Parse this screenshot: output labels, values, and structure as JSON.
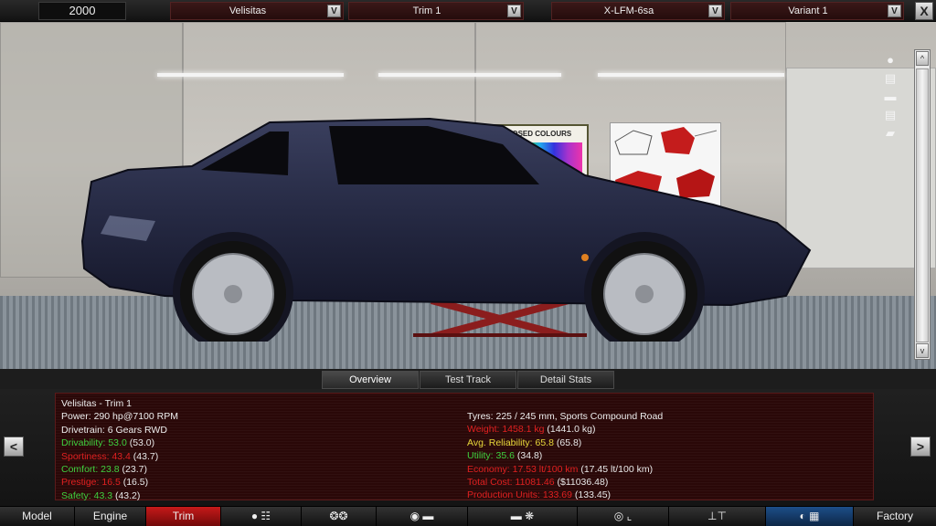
{
  "topbar": {
    "year": "2000",
    "model_dropdown": "Velisitas",
    "trim_dropdown": "Trim 1",
    "engine_dropdown": "X-LFM-6sa",
    "variant_dropdown": "Variant 1",
    "dropdown_arrow": "V",
    "close": "X"
  },
  "scene": {
    "poster_title": "PROPOSED COLOURS",
    "car_color": "#2b2f4a",
    "scroll_up": "^",
    "scroll_down": "v",
    "tools": [
      "camera-icon",
      "car-front-icon",
      "car-side-icon",
      "car-rear-icon",
      "car-top-icon"
    ]
  },
  "tabs": {
    "overview": "Overview",
    "test_track": "Test Track",
    "detail_stats": "Detail Stats"
  },
  "info": {
    "left": [
      {
        "label": "Velisitas - Trim 1",
        "value": "",
        "paren": "",
        "color": "white"
      },
      {
        "label": "Power: 290 hp@7100 RPM",
        "value": "",
        "paren": "",
        "color": "white"
      },
      {
        "label": "Drivetrain: 6 Gears RWD",
        "value": "",
        "paren": "",
        "color": "white"
      },
      {
        "label": "Drivability: 53.0",
        "value": "",
        "paren": " (53.0)",
        "color": "green"
      },
      {
        "label": "Sportiness: 43.4",
        "value": "",
        "paren": " (43.7)",
        "color": "red"
      },
      {
        "label": "Comfort: 23.8",
        "value": "",
        "paren": " (23.7)",
        "color": "green"
      },
      {
        "label": "Prestige: 16.5",
        "value": "",
        "paren": " (16.5)",
        "color": "red"
      },
      {
        "label": "Safety: 43.3",
        "value": "",
        "paren": " (43.2)",
        "color": "green"
      }
    ],
    "right": [
      {
        "label": "Tyres: 225 / 245 mm, Sports Compound Road",
        "paren": "",
        "color": "white"
      },
      {
        "label": "Weight: 1458.1 kg",
        "paren": " (1441.0 kg)",
        "color": "red"
      },
      {
        "label": "Avg. Reliability: 65.8",
        "paren": " (65.8)",
        "color": "yellow"
      },
      {
        "label": "Utility: 35.6",
        "paren": " (34.8)",
        "color": "green"
      },
      {
        "label": "Economy: 17.53 lt/100 km",
        "paren": " (17.45 lt/100 km)",
        "color": "red"
      },
      {
        "label": "Total Cost: 11081.46",
        "paren": " ($11036.48)",
        "color": "red"
      },
      {
        "label": "Production Units: 133.69",
        "paren": " (133.45)",
        "color": "red"
      }
    ],
    "prev": "<",
    "next": ">"
  },
  "nav": {
    "model": "Model",
    "engine": "Engine",
    "trim": "Trim",
    "factory": "Factory",
    "icons": [
      "gearbox-icon",
      "wheel-icon",
      "body-icon",
      "car-icon",
      "fan-icon",
      "steering-icon",
      "seat-icon",
      "suspension-icon",
      "gauge-icon"
    ]
  },
  "colors": {
    "accent_red": "#c61a1a",
    "active_blue": "#1d4e88",
    "green": "#3fd13f",
    "red": "#e02020",
    "yellow": "#e8d83a"
  }
}
